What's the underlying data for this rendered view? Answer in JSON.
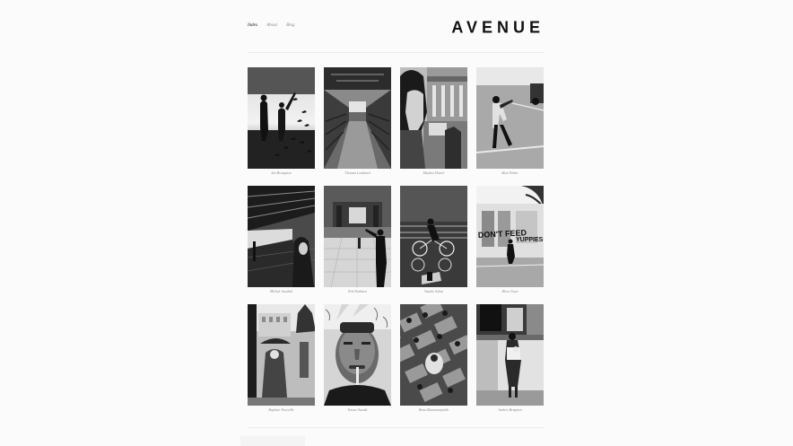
{
  "site": {
    "logo": "AVENUE"
  },
  "nav": {
    "items": [
      {
        "label": "Index",
        "active": true
      },
      {
        "label": "About",
        "active": false
      },
      {
        "label": "Blog",
        "active": false
      }
    ]
  },
  "gallery": {
    "items": [
      {
        "caption": "Ian Brumpton"
      },
      {
        "caption": "Thomas Leuthard"
      },
      {
        "caption": "Markus Hartel"
      },
      {
        "caption": "Matt Weber"
      },
      {
        "caption": "Michal Jarabek"
      },
      {
        "caption": "Erik Rubisen"
      },
      {
        "caption": "Yasuko Sokai"
      },
      {
        "caption": "Kleru Tuan"
      },
      {
        "caption": "Baptiste Esseville"
      },
      {
        "caption": "Tatsuo Suzuki"
      },
      {
        "caption": "Beau Ramsamajolah"
      },
      {
        "caption": "Anders Bergmen"
      }
    ]
  }
}
